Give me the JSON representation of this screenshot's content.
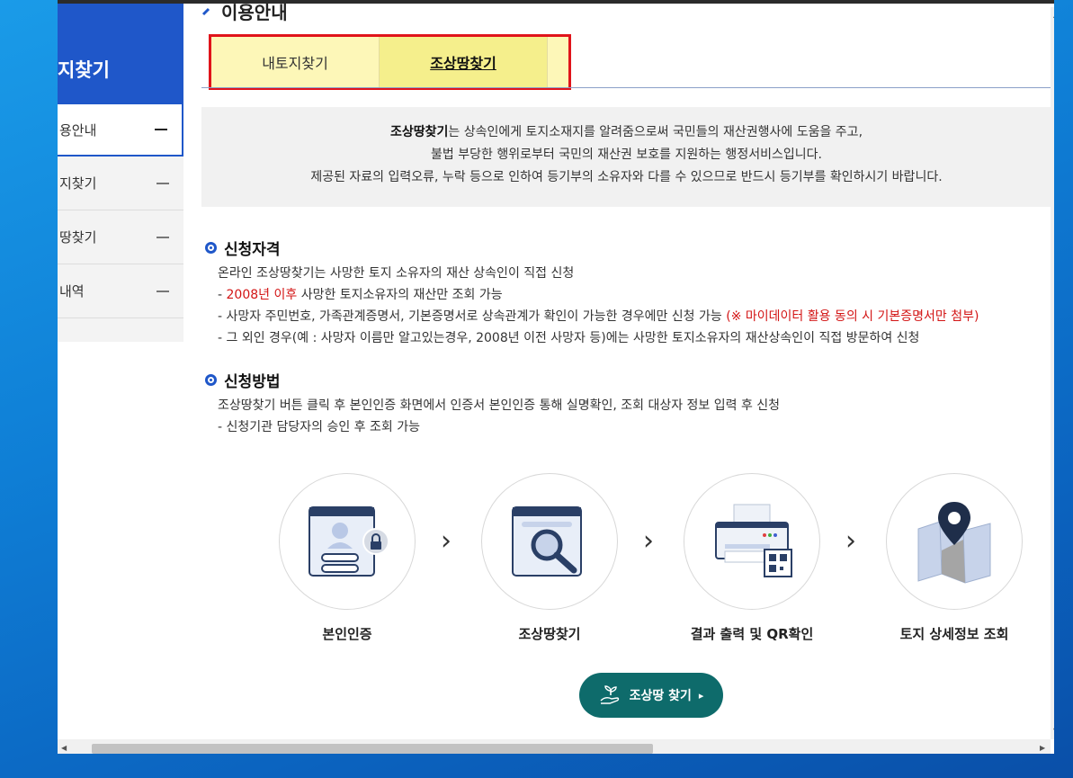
{
  "sidebar": {
    "title": "지찾기",
    "items": [
      {
        "label": "용안내"
      },
      {
        "label": "지찾기"
      },
      {
        "label": "땅찾기"
      },
      {
        "label": "내역"
      }
    ]
  },
  "main": {
    "section_title": "이용안내",
    "tabs": [
      {
        "label": "내토지찾기"
      },
      {
        "label": "조상땅찾기"
      }
    ],
    "intro": {
      "line1_bold": "조상땅찾기",
      "line1_rest": "는 상속인에게 토지소재지를 알려줌으로써 국민들의 재산권행사에 도움을 주고,",
      "line2": "불법 부당한 행위로부터 국민의 재산권 보호를 지원하는 행정서비스입니다.",
      "line3": "제공된 자료의 입력오류, 누락 등으로 인하여 등기부의 소유자와 다를 수 있으므로 반드시 등기부를 확인하시기 바랍니다."
    },
    "eligibility": {
      "title": "신청자격",
      "line1": "온라인 조상땅찾기는 사망한 토지 소유자의 재산 상속인이 직접 신청",
      "line2_prefix": "- ",
      "line2_red": "2008년 이후",
      "line2_rest": " 사망한 토지소유자의 재산만 조회 가능",
      "line3": "- 사망자 주민번호, 가족관계증명서, 기본증명서로 상속관계가 확인이 가능한 경우에만 신청 가능 ",
      "line3_red": "(※ 마이데이터 활용 동의 시 기본증명서만 첨부)",
      "line4": "- 그 외인 경우(예 : 사망자 이름만 알고있는경우, 2008년 이전 사망자 등)에는 사망한 토지소유자의 재산상속인이 직접 방문하여 신청"
    },
    "method": {
      "title": "신청방법",
      "line1": "조상땅찾기 버튼 클릭 후 본인인증 화면에서 인증서 본인인증 통해 실명확인, 조회 대상자 정보 입력 후 신청",
      "line2": "- 신청기관 담당자의 승인 후 조회 가능"
    },
    "steps": [
      {
        "label": "본인인증"
      },
      {
        "label": "조상땅찾기"
      },
      {
        "label": "결과 출력 및 QR확인"
      },
      {
        "label": "토지 상세정보 조회"
      }
    ],
    "cta_label": "조상땅 찾기"
  },
  "colors": {
    "accent": "#1f57c9",
    "highlight_border": "#e0141b",
    "tab_bg": "#fdf7b8",
    "cta": "#0e6b6b",
    "notice_red": "#d31515"
  }
}
